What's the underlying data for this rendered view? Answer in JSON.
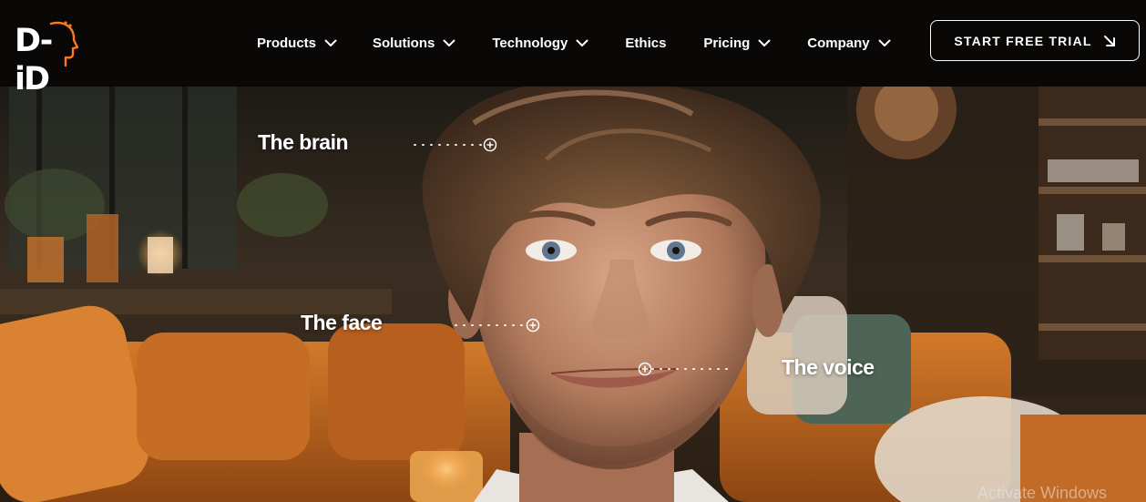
{
  "brand": {
    "logo_text": "D-iD",
    "accent_color": "#ff7a1a"
  },
  "nav": {
    "items": [
      {
        "label": "Products",
        "has_dropdown": true,
        "icon": "chevron-down-icon"
      },
      {
        "label": "Solutions",
        "has_dropdown": true,
        "icon": "chevron-down-icon"
      },
      {
        "label": "Technology",
        "has_dropdown": true,
        "icon": "chevron-down-icon"
      },
      {
        "label": "Ethics",
        "has_dropdown": false
      },
      {
        "label": "Pricing",
        "has_dropdown": true,
        "icon": "chevron-down-icon"
      },
      {
        "label": "Company",
        "has_dropdown": true,
        "icon": "chevron-down-icon"
      }
    ],
    "cta_label": "START FREE TRIAL",
    "cta_icon": "arrow-down-right-icon"
  },
  "hero": {
    "labels": {
      "brain": "The brain",
      "face": "The face",
      "voice": "The voice"
    },
    "marker_icon": "plus-circle-icon"
  },
  "os_overlay": {
    "watermark": "Activate Windows"
  },
  "colors": {
    "navbar_bg": "#0a0807",
    "sofa_orange": "#c8691c",
    "text": "#ffffff"
  }
}
